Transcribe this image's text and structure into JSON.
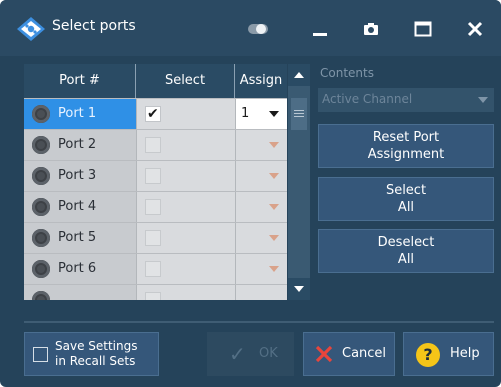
{
  "window": {
    "title": "Select ports",
    "icons": [
      "app-logo-icon",
      "toggle-icon",
      "minimize-icon",
      "camera-icon",
      "maximize-icon",
      "close-icon"
    ]
  },
  "table": {
    "headers": {
      "port": "Port #",
      "select": "Select",
      "assign": "Assign"
    },
    "rows": [
      {
        "port": "Port 1",
        "selected": true,
        "checked": true,
        "assign": "1"
      },
      {
        "port": "Port 2",
        "selected": false,
        "checked": false,
        "assign": ""
      },
      {
        "port": "Port 3",
        "selected": false,
        "checked": false,
        "assign": ""
      },
      {
        "port": "Port 4",
        "selected": false,
        "checked": false,
        "assign": ""
      },
      {
        "port": "Port 5",
        "selected": false,
        "checked": false,
        "assign": ""
      },
      {
        "port": "Port 6",
        "selected": false,
        "checked": false,
        "assign": ""
      }
    ],
    "check_mark": "✔"
  },
  "side_panel": {
    "contents_label": "Contents",
    "contents_value": "Active Channel",
    "reset_button": "Reset Port\nAssignment",
    "select_all_button": "Select\nAll",
    "deselect_all_button": "Deselect\nAll"
  },
  "footer": {
    "save_settings_label": "Save Settings\nin Recall Sets",
    "save_settings_checked": false,
    "ok_label": "OK",
    "cancel_label": "Cancel",
    "help_label": "Help",
    "help_glyph": "?",
    "ok_glyph": "✓"
  },
  "colors": {
    "dialog_bg": "#25435a",
    "selection": "#2f90e6",
    "cancel_x": "#e8453c",
    "help_icon": "#f5c518"
  }
}
